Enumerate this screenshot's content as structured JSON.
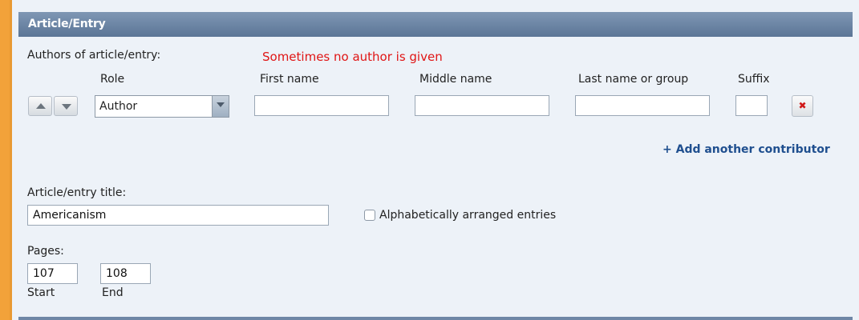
{
  "section": {
    "title": "Article/Entry"
  },
  "authors": {
    "label": "Authors of article/entry:",
    "note": "Sometimes no author is given",
    "columns": {
      "role": "Role",
      "first": "First name",
      "middle": "Middle name",
      "last": "Last name or group",
      "suffix": "Suffix"
    },
    "row": {
      "role_value": "Author",
      "first_value": "",
      "middle_value": "",
      "last_value": "",
      "suffix_value": ""
    },
    "add_link": "+ Add another contributor"
  },
  "title_field": {
    "label": "Article/entry title:",
    "value": "Americanism"
  },
  "alpha_checkbox": {
    "label": "Alphabetically arranged entries",
    "checked": false
  },
  "pages": {
    "label": "Pages:",
    "start_value": "107",
    "end_value": "108",
    "start_label": "Start",
    "end_label": "End"
  },
  "colors": {
    "header": "#6b84a3",
    "accent_border": "#f2a23a",
    "note": "#e01515",
    "link": "#1f4f8f"
  },
  "icons": [
    "arrow-up-icon",
    "arrow-down-icon",
    "chevron-down-icon",
    "delete-icon"
  ]
}
